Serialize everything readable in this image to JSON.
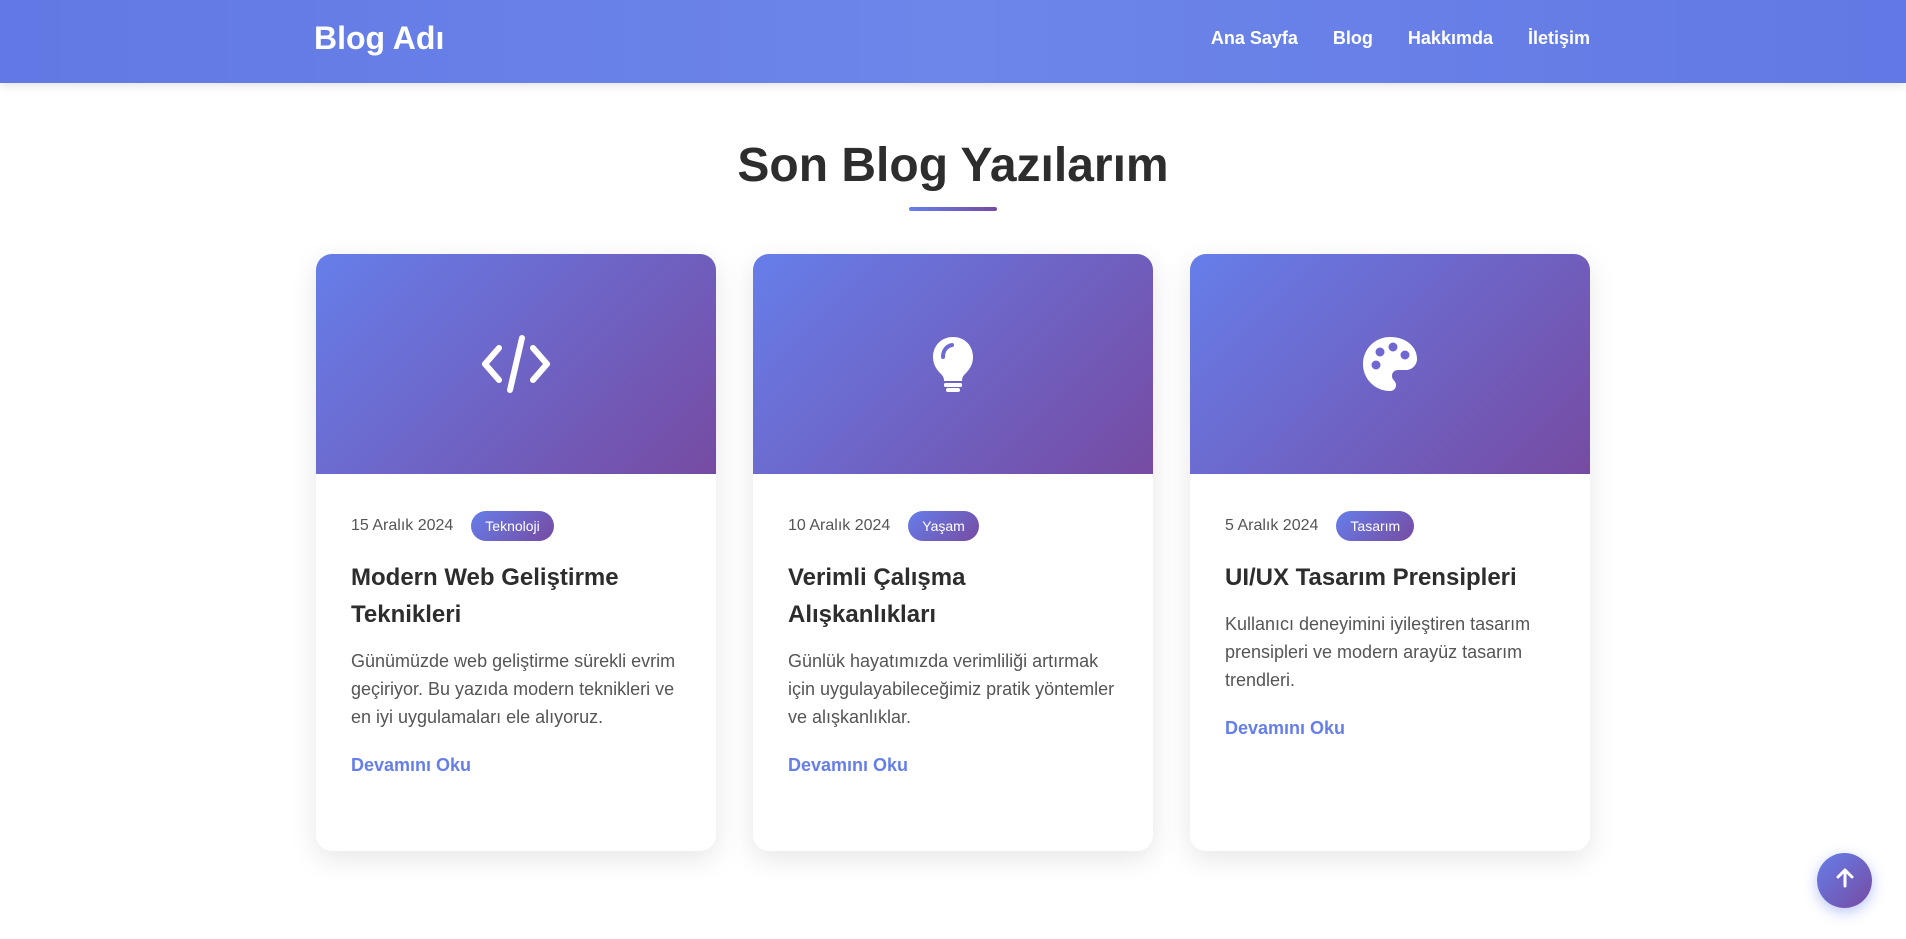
{
  "header": {
    "brand": "Blog Adı",
    "nav": [
      "Ana Sayfa",
      "Blog",
      "Hakkımda",
      "İletişim"
    ]
  },
  "section": {
    "title": "Son Blog Yazılarım"
  },
  "posts": [
    {
      "icon": "code-icon",
      "date": "15 Aralık 2024",
      "tag": "Teknoloji",
      "title": "Modern Web Geliştirme Teknikleri",
      "excerpt": "Günümüzde web geliştirme sürekli evrim geçiriyor. Bu yazıda modern teknikleri ve en iyi uygulamaları ele alıyoruz.",
      "read_more": "Devamını Oku"
    },
    {
      "icon": "lightbulb-icon",
      "date": "10 Aralık 2024",
      "tag": "Yaşam",
      "title": "Verimli Çalışma Alışkanlıkları",
      "excerpt": "Günlük hayatımızda verimliliği artırmak için uygulayabileceğimiz pratik yöntemler ve alışkanlıklar.",
      "read_more": "Devamını Oku"
    },
    {
      "icon": "palette-icon",
      "date": "5 Aralık 2024",
      "tag": "Tasarım",
      "title": "UI/UX Tasarım Prensipleri",
      "excerpt": "Kullanıcı deneyimini iyileştiren tasarım prensipleri ve modern arayüz tasarım trendleri.",
      "read_more": "Devamını Oku"
    }
  ],
  "scroll_top": {
    "icon": "arrow-up-icon"
  },
  "colors": {
    "accent_start": "#667eea",
    "accent_end": "#764ba2",
    "header": "#6b83ea"
  }
}
